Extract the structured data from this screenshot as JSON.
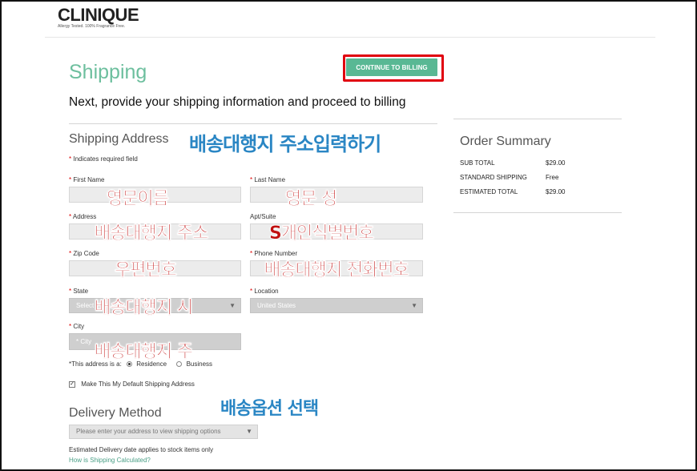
{
  "brand": {
    "logo": "CLINIQUE",
    "tagline": "Allergy Tested. 100% Fragrance Free."
  },
  "header": {
    "title": "Shipping",
    "continue_button": "CONTINUE TO BILLING",
    "intro": "Next, provide your shipping information and proceed to billing"
  },
  "shipping_address": {
    "title": "Shipping Address",
    "required_note": "Indicates required field",
    "fields": {
      "first_name": {
        "label": "First Name",
        "required": true,
        "value": ""
      },
      "last_name": {
        "label": "Last Name",
        "required": true,
        "value": ""
      },
      "address": {
        "label": "Address",
        "required": true,
        "value": ""
      },
      "apt": {
        "label": "Apt/Suite",
        "required": false,
        "value": ""
      },
      "zip": {
        "label": "Zip Code",
        "required": true,
        "value": ""
      },
      "phone": {
        "label": "Phone Number",
        "required": true,
        "value": ""
      },
      "state": {
        "label": "State",
        "required": true,
        "value": "Select"
      },
      "location": {
        "label": "Location",
        "required": true,
        "value": "United States"
      },
      "city": {
        "label": "City",
        "required": true,
        "placeholder": "* City"
      }
    },
    "address_type": {
      "label": "*This address is a:",
      "options": [
        "Residence",
        "Business"
      ],
      "selected": "Residence"
    },
    "default_checkbox": {
      "label": "Make This My Default Shipping Address",
      "checked": true
    }
  },
  "delivery": {
    "title": "Delivery Method",
    "select_placeholder": "Please enter your address to view shipping options",
    "note": "Estimated Delivery date applies to stock items only",
    "link": "How is Shipping Calculated?"
  },
  "order_summary": {
    "title": "Order Summary",
    "rows": [
      {
        "label": "SUB TOTAL",
        "value": "$29.00"
      },
      {
        "label": "STANDARD SHIPPING",
        "value": "Free"
      },
      {
        "label": "ESTIMATED TOTAL",
        "value": "$29.00"
      }
    ]
  },
  "annotations": {
    "address_section": "배송대행지 주소입력하기",
    "first_name": "영문이름",
    "last_name": "영문 성",
    "address": "배송대행지 주소",
    "apt": "S개인식별번호",
    "zip": "우편번호",
    "phone": "배송대행지 전화번호",
    "state": "배송대행지 시",
    "city": "배송대행지 주",
    "delivery": "배송옵션 선택"
  },
  "colors": {
    "accent": "#59b894",
    "title_green": "#6dbf9e",
    "highlight": "#e0000f",
    "annot_red": "#c01010",
    "annot_blue": "#2a86c4"
  }
}
